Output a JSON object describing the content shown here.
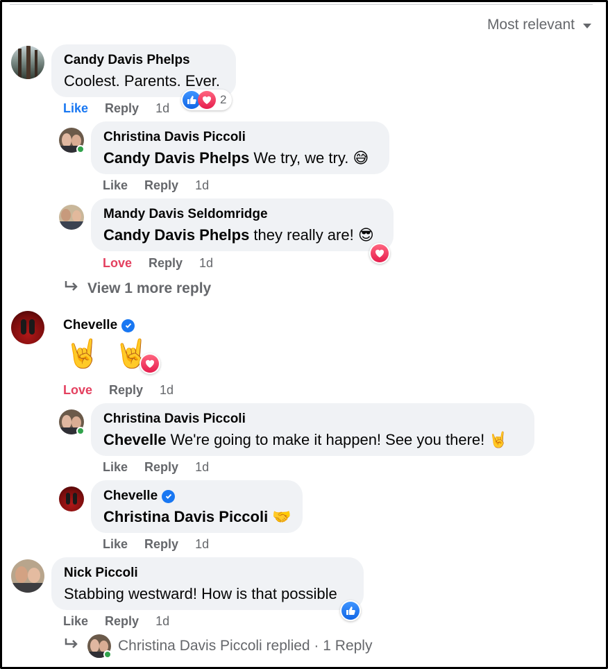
{
  "sort": {
    "label": "Most relevant"
  },
  "comments": {
    "c1": {
      "author": "Candy Davis Phelps",
      "text": "Coolest. Parents. Ever.",
      "like": "Like",
      "reply": "Reply",
      "time": "1d",
      "reaction_count": "2"
    },
    "r1": {
      "author": "Christina Davis Piccoli",
      "mention": "Candy Davis Phelps",
      "text": " We try, we try. 😅",
      "like": "Like",
      "reply": "Reply",
      "time": "1d"
    },
    "r2": {
      "author": "Mandy Davis Seldomridge",
      "mention": "Candy Davis Phelps",
      "text": " they really are! 😎",
      "like": "Love",
      "reply": "Reply",
      "time": "1d"
    },
    "view_more": "View 1 more reply",
    "c2": {
      "author": "Chevelle",
      "text": "🤘 🤘",
      "like": "Love",
      "reply": "Reply",
      "time": "1d"
    },
    "r3": {
      "author": "Christina Davis Piccoli",
      "mention": "Chevelle",
      "text": " We're going to make it happen! See you there! 🤘",
      "like": "Like",
      "reply": "Reply",
      "time": "1d"
    },
    "r4": {
      "author": "Chevelle",
      "mention": "Christina Davis Piccoli",
      "text": " 🤝",
      "like": "Like",
      "reply": "Reply",
      "time": "1d"
    },
    "c3": {
      "author": "Nick Piccoli",
      "text": "Stabbing westward! How is that possible",
      "like": "Like",
      "reply": "Reply",
      "time": "1d"
    },
    "replied": {
      "text": "Christina Davis Piccoli replied · 1 Reply"
    }
  },
  "colors": {
    "accent_blue": "#1877f2",
    "love_red": "#e4405f",
    "bubble_bg": "#f0f2f5",
    "secondary_text": "#65676b"
  },
  "icons": [
    "like-reaction-icon",
    "love-reaction-icon",
    "verified-badge-icon",
    "reply-arrow-icon",
    "sort-caret-icon",
    "online-status-icon"
  ]
}
